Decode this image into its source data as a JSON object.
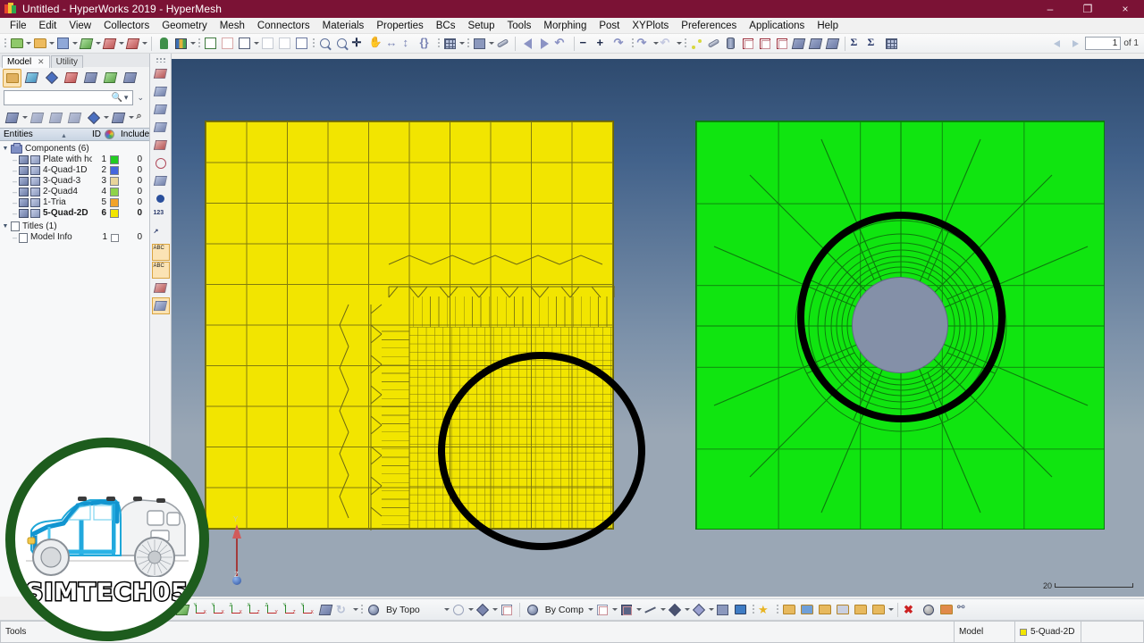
{
  "window": {
    "title": "Untitled - HyperWorks 2019 - HyperMesh",
    "app_icon": "hyperworks-icon",
    "minimize": "–",
    "maximize": "❐",
    "close": "×"
  },
  "menubar": {
    "items": [
      {
        "label": "File"
      },
      {
        "label": "Edit"
      },
      {
        "label": "View"
      },
      {
        "label": "Collectors"
      },
      {
        "label": "Geometry"
      },
      {
        "label": "Mesh"
      },
      {
        "label": "Connectors"
      },
      {
        "label": "Materials"
      },
      {
        "label": "Properties"
      },
      {
        "label": "BCs"
      },
      {
        "label": "Setup"
      },
      {
        "label": "Tools"
      },
      {
        "label": "Morphing"
      },
      {
        "label": "Post"
      },
      {
        "label": "XYPlots"
      },
      {
        "label": "Preferences"
      },
      {
        "label": "Applications"
      },
      {
        "label": "Help"
      }
    ]
  },
  "toolbar_top": {
    "page_nav": {
      "prev_icon": "arrow-left-icon",
      "next_icon": "arrow-right-icon",
      "page_value": "1",
      "of_label": "of 1"
    },
    "buttons": [
      {
        "icon": "new-model-icon"
      },
      {
        "icon": "open-model-icon"
      },
      {
        "icon": "save-model-icon"
      },
      {
        "icon": "import-solver-deck-icon"
      },
      {
        "icon": "export-solver-deck-icon"
      },
      {
        "icon": "export-ppt-icon"
      },
      {
        "icon": "user-profile-icon"
      },
      {
        "icon": "session-icon"
      },
      {
        "icon": "new-page-icon"
      },
      {
        "icon": "delete-page-icon"
      },
      {
        "icon": "single-window-icon"
      },
      {
        "icon": "two-window-icon"
      },
      {
        "icon": "four-window-icon"
      },
      {
        "icon": "page-window-icon"
      },
      {
        "icon": "zoom-in-icon"
      },
      {
        "icon": "zoom-out-icon"
      },
      {
        "icon": "fit-view-icon"
      },
      {
        "icon": "pan-icon"
      },
      {
        "icon": "arrow-horizontal-icon"
      },
      {
        "icon": "arrow-vertical-icon"
      },
      {
        "icon": "rotate-free-icon"
      },
      {
        "icon": "shaded-mesh-icon"
      },
      {
        "icon": "shaded-elements-icon"
      },
      {
        "icon": "wireframe-icon"
      },
      {
        "icon": "undo-view-icon"
      },
      {
        "icon": "redo-view-icon"
      },
      {
        "icon": "rotate-left-icon"
      },
      {
        "icon": "zoom-minus-icon"
      },
      {
        "icon": "zoom-plus-icon"
      },
      {
        "icon": "rotate-right-icon"
      },
      {
        "icon": "rotate-cw-icon"
      },
      {
        "icon": "rotate-ccw-icon"
      },
      {
        "icon": "node-edit-icon"
      },
      {
        "icon": "line-edit-icon"
      },
      {
        "icon": "surface-edit-icon"
      },
      {
        "icon": "solid-map-icon"
      },
      {
        "icon": "tetra-mesh-icon"
      },
      {
        "icon": "hex-mesh-icon"
      },
      {
        "icon": "mesh-split-icon"
      },
      {
        "icon": "mesh-mirror-icon"
      },
      {
        "icon": "mesh-project-icon"
      },
      {
        "icon": "summation-icon"
      },
      {
        "icon": "summation-alt-icon"
      },
      {
        "icon": "matrix-browser-icon"
      }
    ]
  },
  "left_panel": {
    "tabs": [
      {
        "label": "Model",
        "active": true,
        "close_icon": "close-icon"
      },
      {
        "label": "Utility",
        "active": false
      }
    ],
    "browser_buttons": [
      {
        "icon": "model-browser-icon",
        "selected": true
      },
      {
        "icon": "solver-browser-icon",
        "selected": false
      },
      {
        "icon": "part-browser-icon",
        "selected": false
      },
      {
        "icon": "include-browser-icon",
        "selected": false
      },
      {
        "icon": "connector-browser-icon",
        "selected": false
      },
      {
        "icon": "entity-state-browser-icon",
        "selected": false
      },
      {
        "icon": "mesh-controls-icon",
        "selected": false
      }
    ],
    "search": {
      "value": "",
      "placeholder": "",
      "search_icon": "search-icon",
      "dropdown_icon": "chevron-down-icon",
      "expand_icon": "double-chevron-icon"
    },
    "view_buttons": [
      {
        "icon": "display-all-icon"
      },
      {
        "icon": "hide-all-icon"
      },
      {
        "icon": "show-reverse-icon"
      },
      {
        "icon": "show-isolate-icon"
      },
      {
        "icon": "shaded-geometry-icon"
      },
      {
        "icon": "element-display-icon"
      },
      {
        "icon": "pointer-icon"
      },
      {
        "icon": "sync-browser-icon"
      }
    ],
    "columns": {
      "entities": "Entities",
      "id": "ID",
      "color": "color-wheel-icon",
      "include": "Include"
    },
    "tree": [
      {
        "type": "group",
        "label": "Components (6)",
        "icon": "components-folder-icon",
        "expanded": true,
        "children": [
          {
            "label": "Plate with hole",
            "id": "1",
            "color": "#22cc22",
            "include": "0",
            "bold": false
          },
          {
            "label": "4-Quad-1D",
            "id": "2",
            "color": "#4466dd",
            "include": "0",
            "bold": false
          },
          {
            "label": "3-Quad-3",
            "id": "3",
            "color": "#e8d49a",
            "include": "0",
            "bold": false
          },
          {
            "label": "2-Quad4",
            "id": "4",
            "color": "#8ed34a",
            "include": "0",
            "bold": false
          },
          {
            "label": "1-Tria",
            "id": "5",
            "color": "#f2a32a",
            "include": "0",
            "bold": false
          },
          {
            "label": "5-Quad-2D",
            "id": "6",
            "color": "#f2e500",
            "include": "0",
            "bold": true
          }
        ]
      },
      {
        "type": "group",
        "label": "Titles (1)",
        "icon": "titles-folder-icon",
        "expanded": true,
        "children": [
          {
            "label": "Model Info",
            "id": "1",
            "color": "#ffffff",
            "include": "0",
            "bold": false,
            "checkbox": true
          }
        ]
      }
    ]
  },
  "vertical_toolbar": {
    "buttons": [
      {
        "icon": "geometry-panel-icon"
      },
      {
        "icon": "mesh-edit-icon"
      },
      {
        "icon": "surface-mesh-icon"
      },
      {
        "icon": "element-quality-icon"
      },
      {
        "icon": "mesh-check-icon"
      },
      {
        "icon": "mask-elements-icon"
      },
      {
        "icon": "mesh-density-icon"
      },
      {
        "icon": "node-id-icon"
      },
      {
        "icon": "numbers-icon"
      },
      {
        "icon": "measure-icon"
      },
      {
        "icon": "element-label-icon"
      },
      {
        "icon": "annotation-icon"
      },
      {
        "icon": "vector-plot-icon"
      },
      {
        "icon": "shaded-plate-icon",
        "selected": true
      }
    ]
  },
  "viewport": {
    "background": "#7d92aa",
    "models": [
      {
        "name": "yellow-mesh-plate",
        "component": "5-Quad-2D",
        "color": "#f2e500",
        "description": "Square plate with coarse quad mesh and locally refined quad mesh in lower-right quadrant",
        "annotation": "black-circle-highlight"
      },
      {
        "name": "green-plate-with-hole",
        "component": "Plate with hole",
        "color": "#10e510",
        "hole_color": "#8490a8",
        "description": "Square plate with central circular hole and radial washer mesh refinement",
        "annotation": "black-circle-highlight"
      }
    ],
    "axis_triad": {
      "y_label": "Y",
      "z_label": "Z"
    },
    "scale_bar": {
      "value": "20"
    }
  },
  "toolbar_bottom": {
    "buttons": [
      {
        "icon": "global-axis-icon"
      },
      {
        "icon": "xy-view-icon"
      },
      {
        "icon": "yx-view-icon"
      },
      {
        "icon": "zx-view-icon"
      },
      {
        "icon": "xz-view-icon"
      },
      {
        "icon": "zy-view-icon"
      },
      {
        "icon": "yz-view-icon"
      },
      {
        "icon": "iso-view-icon"
      },
      {
        "icon": "set-view-icon"
      },
      {
        "icon": "rotate-view-icon"
      }
    ],
    "selectors": [
      {
        "icon": "topology-display-icon",
        "label": "By Topo",
        "dropdown_icon": "chevron-down-icon"
      },
      {
        "icon": "surface-wire-icon",
        "dropdown_icon": "chevron-down-icon"
      },
      {
        "icon": "surface-shaded-icon",
        "dropdown_icon": "chevron-down-icon"
      },
      {
        "icon": "solid-shaded-icon",
        "dropdown_icon": "chevron-down-icon"
      },
      {
        "icon": "component-color-icon",
        "label": "By Comp",
        "dropdown_icon": "chevron-down-icon"
      }
    ],
    "buttons2": [
      {
        "icon": "wireframe-elements-icon"
      },
      {
        "icon": "shaded-elements-edges-icon"
      },
      {
        "icon": "element-1d-icon"
      },
      {
        "icon": "element-2d-icon"
      },
      {
        "icon": "element-3d-icon"
      },
      {
        "icon": "element-mixed-icon"
      },
      {
        "icon": "display-monitor-icon"
      },
      {
        "icon": "favorites-star-icon"
      },
      {
        "icon": "model-import-icon"
      },
      {
        "icon": "model-open-icon"
      },
      {
        "icon": "include-files-icon"
      },
      {
        "icon": "connectors-icon"
      },
      {
        "icon": "import-arrow-icon"
      },
      {
        "icon": "export-arrow-icon"
      },
      {
        "icon": "delete-red-x-icon"
      },
      {
        "icon": "layers-icon"
      },
      {
        "icon": "export-file-icon"
      },
      {
        "icon": "check-tool-icon"
      }
    ]
  },
  "statusbar": {
    "tools_label": "Tools",
    "model_label": "Model",
    "component_label": "5-Quad-2D",
    "component_color": "#f2e500"
  },
  "watermark": {
    "text": "SIMTECH05",
    "ring_color": "#1d5c1d",
    "image": "car-body-fea-model"
  }
}
